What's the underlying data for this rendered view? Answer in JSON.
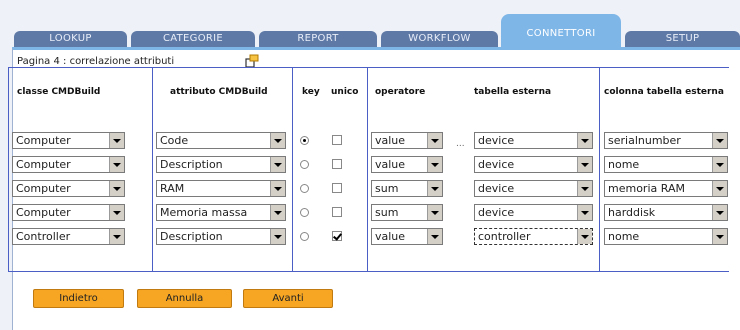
{
  "tabs": [
    {
      "label": "LOOKUP",
      "active": false
    },
    {
      "label": "CATEGORIE",
      "active": false
    },
    {
      "label": "REPORT",
      "active": false
    },
    {
      "label": "WORKFLOW",
      "active": false
    },
    {
      "label": "CONNETTORI",
      "active": true
    },
    {
      "label": "SETUP",
      "active": false
    }
  ],
  "page": {
    "title": "Pagina 4 : correlazione attributi",
    "icon": "window-icon"
  },
  "columns": {
    "classe": "classe CMDBuild",
    "attributo": "attributo CMDBuild",
    "key": "key",
    "unico": "unico",
    "operatore": "operatore",
    "tabella": "tabella esterna",
    "colonna": "colonna tabella esterna"
  },
  "rows": [
    {
      "classe": "Computer",
      "attributo": "Code",
      "key": true,
      "unico": false,
      "operatore": "value",
      "tabella": "device",
      "colonna": "serialnumber"
    },
    {
      "classe": "Computer",
      "attributo": "Description",
      "key": false,
      "unico": false,
      "operatore": "value",
      "tabella": "device",
      "colonna": "nome"
    },
    {
      "classe": "Computer",
      "attributo": "RAM",
      "key": false,
      "unico": false,
      "operatore": "sum",
      "tabella": "device",
      "colonna": "memoria RAM"
    },
    {
      "classe": "Computer",
      "attributo": "Memoria massa",
      "key": false,
      "unico": false,
      "operatore": "sum",
      "tabella": "device",
      "colonna": "harddisk"
    },
    {
      "classe": "Controller",
      "attributo": "Description",
      "key": false,
      "unico": true,
      "operatore": "value",
      "tabella": "controller",
      "colonna": "nome"
    }
  ],
  "ellipsis": "...",
  "buttons": {
    "back": "Indietro",
    "cancel": "Annulla",
    "next": "Avanti"
  },
  "colors": {
    "tab": "#5f79a6",
    "tab_active": "#7fb6e8",
    "button": "#f6a623",
    "grid_border": "#4a5ec6"
  }
}
